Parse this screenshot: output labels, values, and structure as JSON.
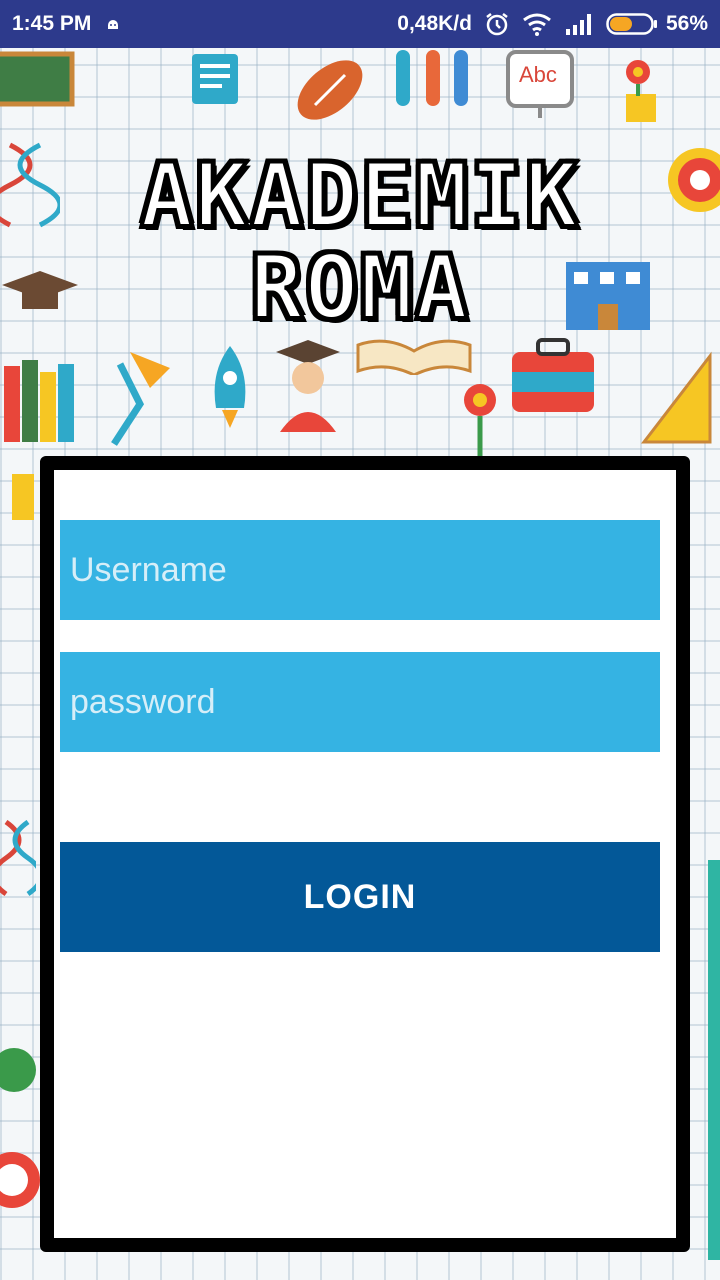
{
  "status_bar": {
    "time": "1:45 PM",
    "network_speed": "0,48K/d",
    "battery_percent": "56%",
    "battery_level": 0.56,
    "icons": [
      "android-debug-icon",
      "alarm-icon",
      "wifi-icon",
      "signal-icon",
      "battery-icon"
    ]
  },
  "header": {
    "title_line1": "AKADEMIK",
    "title_line2": "ROMA"
  },
  "login": {
    "username_placeholder": "Username",
    "password_placeholder": "password",
    "login_label": "LOGIN"
  },
  "decor": {
    "abc_label": "Abc",
    "colors": {
      "status_bar": "#2d3a8c",
      "field": "#35b3e3",
      "button": "#035898"
    }
  }
}
